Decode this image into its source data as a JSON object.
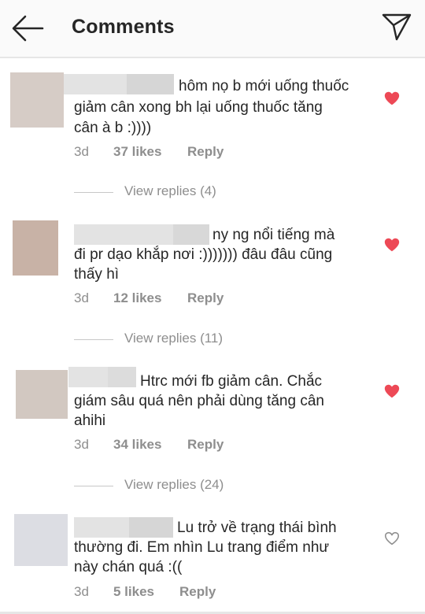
{
  "header": {
    "title": "Comments",
    "back_icon": "arrow-left-icon",
    "send_icon": "paper-plane-icon"
  },
  "comments": [
    {
      "text_line1": "hôm nọ b mới uống thuốc",
      "text_line2": "giảm cân xong bh lại uống thuốc tăng",
      "text_line3": "cân à b :))))",
      "time": "3d",
      "likes": "37 likes",
      "reply": "Reply",
      "view_replies": "View replies (4)",
      "liked": true
    },
    {
      "text_line1": "ny ng nổi tiếng mà",
      "text_line2": "đi pr dạo khắp nơi :))))))) đâu đâu cũng",
      "text_line3": "thấy hì",
      "time": "3d",
      "likes": "12 likes",
      "reply": "Reply",
      "view_replies": "View replies (11)",
      "liked": true
    },
    {
      "text_line1": "Htrc mới fb giảm cân. Chắc",
      "text_line2": "giám sâu quá nên phải dùng tăng cân",
      "text_line3": "ahihi",
      "time": "3d",
      "likes": "34 likes",
      "reply": "Reply",
      "view_replies": "View replies (24)",
      "liked": true
    },
    {
      "text_line1": "Lu trở về trạng thái bình",
      "text_line2": "thường đi. Em nhìn Lu trang điểm như",
      "text_line3": "này chán quá :((",
      "time": "3d",
      "likes": "5 likes",
      "reply": "Reply",
      "liked": false
    }
  ],
  "colors": {
    "heart_liked": "#ed4956",
    "heart_unliked": "#8e8e8e",
    "muted_text": "#8e8e8e"
  }
}
